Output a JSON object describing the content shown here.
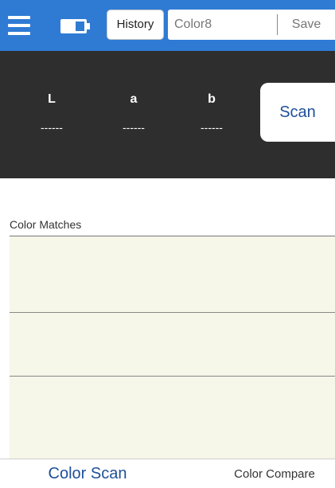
{
  "toolbar": {
    "menu_icon": "hamburger-menu-icon",
    "battery_icon": "battery-icon",
    "history_label": "History",
    "name_value": "Color8",
    "save_label": "Save",
    "accent_color": "#2f7bd4"
  },
  "lab": {
    "l_label": "L",
    "l_value": "------",
    "a_label": "a",
    "a_value": "------",
    "b_label": "b",
    "b_value": "------",
    "scan_label": "Scan",
    "panel_color": "#2e2e2e"
  },
  "matches": {
    "header": "Color Matches",
    "background_color": "#f6f6e9",
    "rows": [
      "",
      "",
      ""
    ]
  },
  "tabs": {
    "color_scan": "Color Scan",
    "color_compare": "Color Compare",
    "active_color": "#1f4f9a"
  }
}
